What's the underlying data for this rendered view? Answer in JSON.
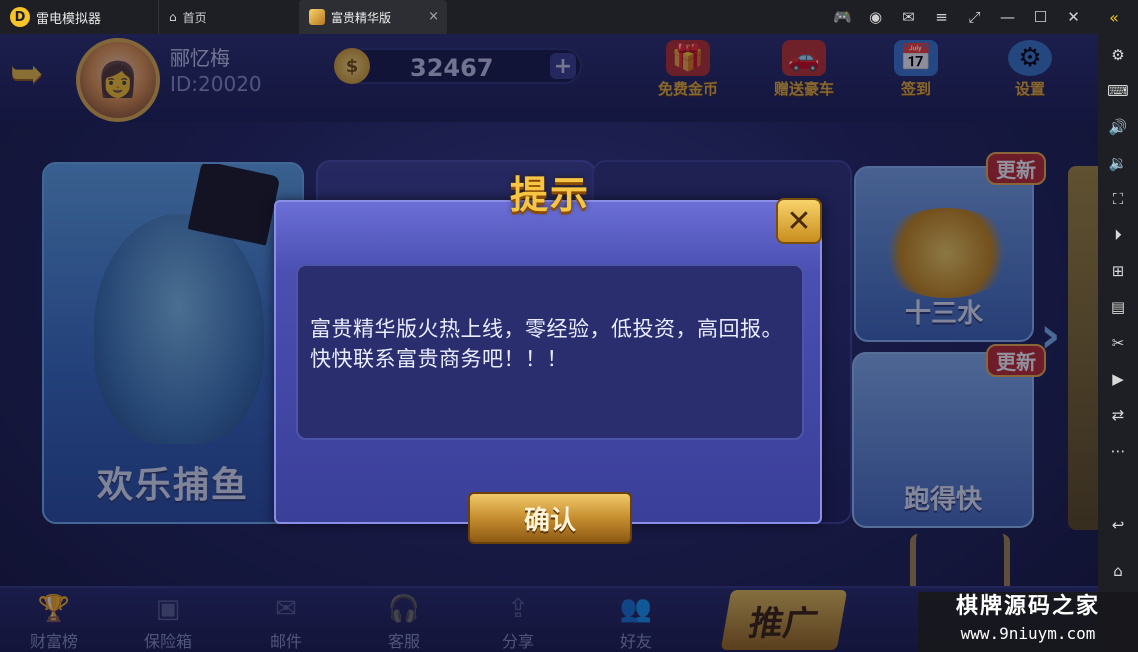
{
  "titlebar": {
    "app_name": "雷电模拟器",
    "tabs": [
      {
        "label": "首页",
        "icon": "home-icon"
      },
      {
        "label": "富贵精华版",
        "icon": "game-thumbnail"
      }
    ],
    "tab_close": "×"
  },
  "profile": {
    "name": "郦忆梅",
    "id": "ID:20020"
  },
  "coins": {
    "value": "32467",
    "add": "+"
  },
  "top_actions": [
    {
      "label": "免费金币",
      "icon": "gift-icon"
    },
    {
      "label": "赠送豪车",
      "icon": "car-icon"
    },
    {
      "label": "签到",
      "icon": "calendar-icon"
    },
    {
      "label": "设置",
      "icon": "gear-icon"
    }
  ],
  "games": {
    "fish": "欢乐捕鱼",
    "thirteen": "十三水",
    "paodekuai": "跑得快",
    "new_badge": "更新"
  },
  "bottom_nav": [
    {
      "label": "财富榜",
      "icon": "trophy-icon"
    },
    {
      "label": "保险箱",
      "icon": "safe-icon"
    },
    {
      "label": "邮件",
      "icon": "mail-icon"
    },
    {
      "label": "客服",
      "icon": "headset-icon"
    },
    {
      "label": "分享",
      "icon": "share-icon"
    },
    {
      "label": "好友",
      "icon": "friends-icon"
    }
  ],
  "promote": "推广",
  "dialog": {
    "title": "提示",
    "message": "富贵精华版火热上线，零经验，低投资，高回报。快快联系富贵商务吧！！！",
    "confirm": "确认",
    "close": "✕"
  },
  "watermark": {
    "line1": "棋牌源码之家",
    "line2": "www.9niuym.com"
  },
  "colors": {
    "accent_gold": "#f6c543",
    "dialog_bg": "#3a3f98",
    "titlebar_bg": "#1e1f24"
  }
}
